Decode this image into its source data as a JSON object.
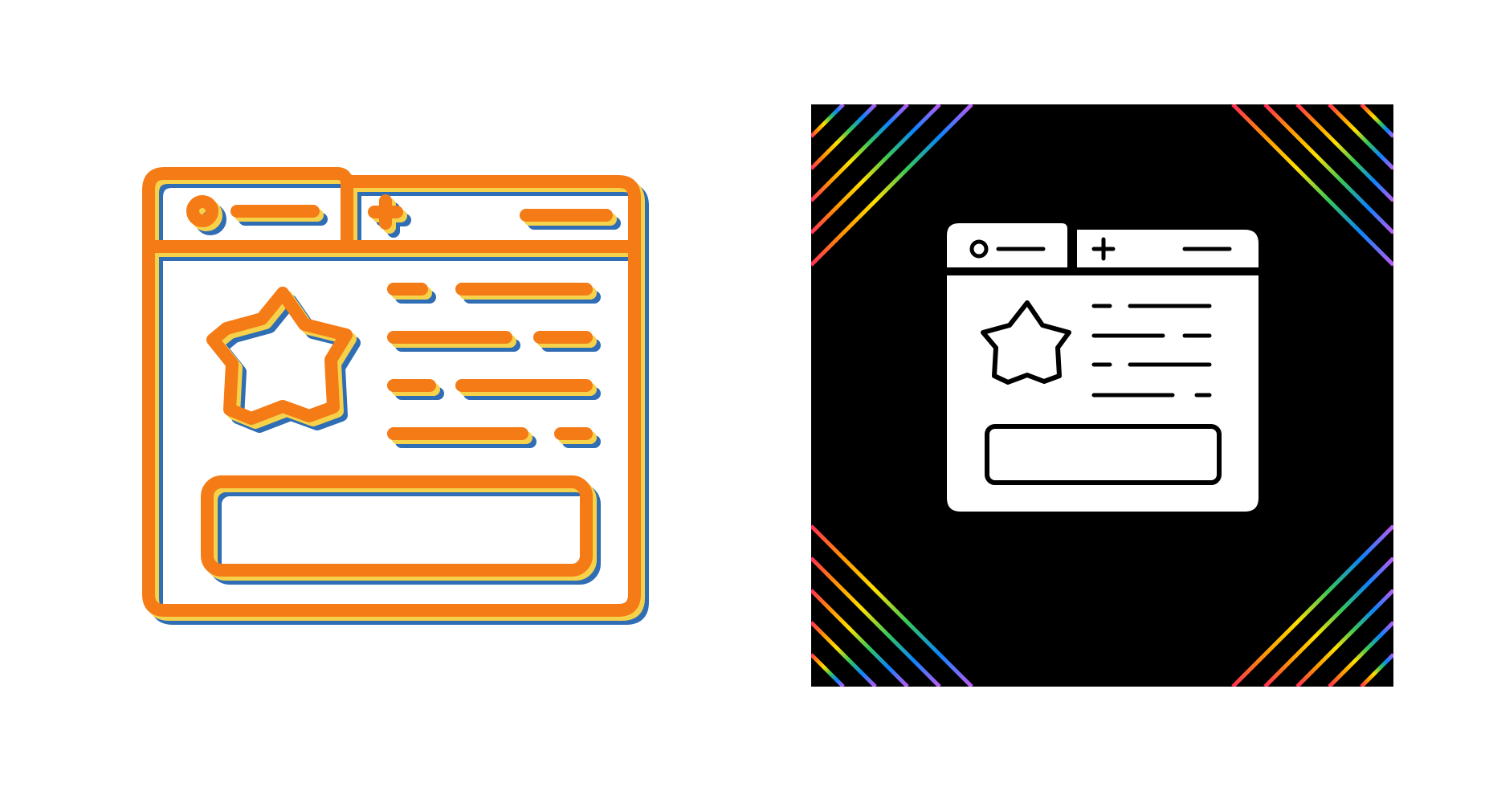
{
  "colors": {
    "background": "#ffffff",
    "accent_orange": "#f47b16",
    "shadow_blue": "#2f6db5",
    "shadow_yellow": "#f6d24b",
    "dark_panel": "#000000",
    "glyph_white": "#ffffff"
  },
  "left_icon": {
    "icon": "browser-window-star-icon",
    "style": "outline-offset"
  },
  "right_icon": {
    "icon": "browser-window-star-icon",
    "style": "glyph-on-dark",
    "corner_decoration": "rainbow-diagonal-stripes"
  }
}
